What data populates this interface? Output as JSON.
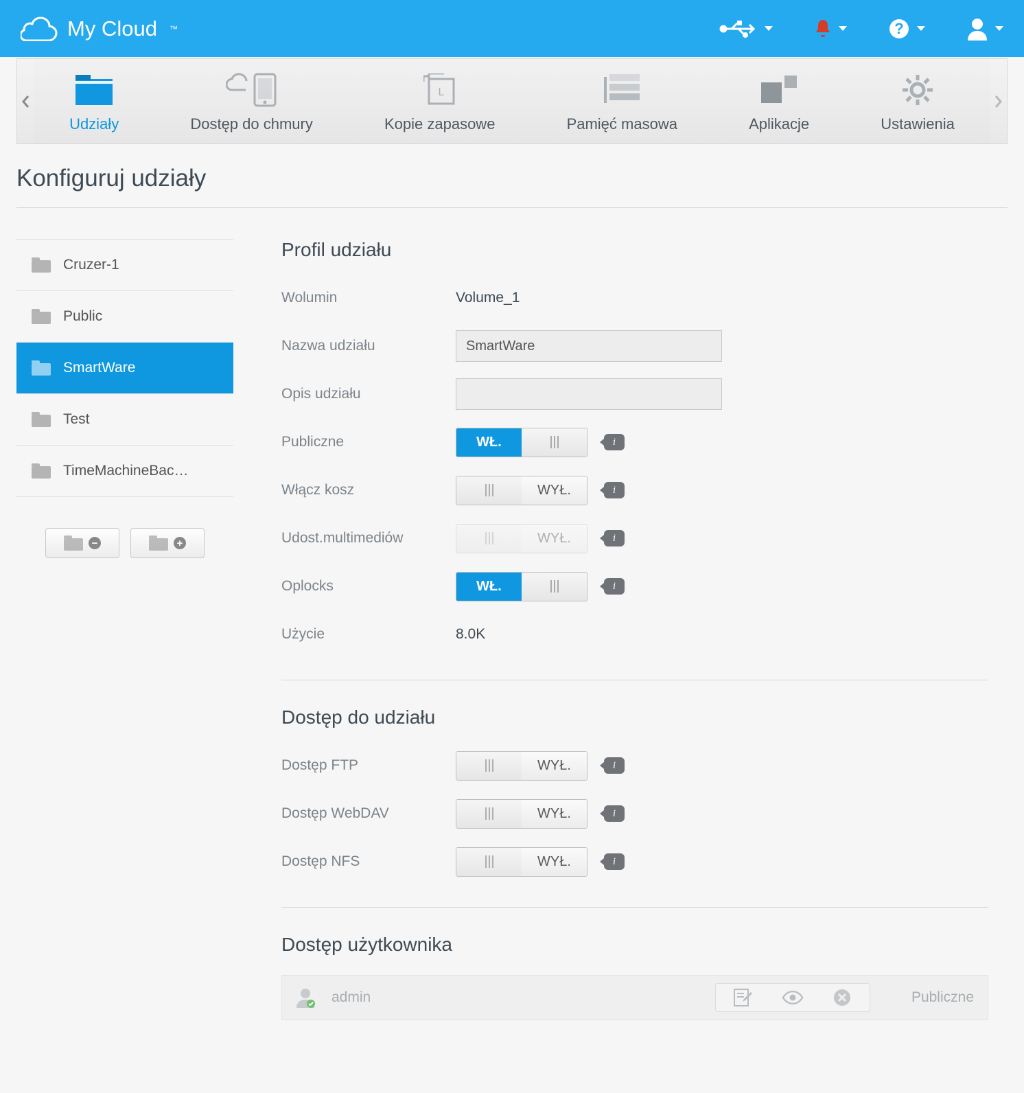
{
  "brand": "My Cloud",
  "nav": [
    {
      "label": "Udziały",
      "active": true
    },
    {
      "label": "Dostęp do chmury"
    },
    {
      "label": "Kopie zapasowe"
    },
    {
      "label": "Pamięć masowa"
    },
    {
      "label": "Aplikacje"
    },
    {
      "label": "Ustawienia"
    }
  ],
  "page_title": "Konfiguruj udziały",
  "shares": [
    {
      "name": "Cruzer-1"
    },
    {
      "name": "Public"
    },
    {
      "name": "SmartWare",
      "selected": true
    },
    {
      "name": "Test"
    },
    {
      "name": "TimeMachineBac…"
    }
  ],
  "toggle_labels": {
    "on": "WŁ.",
    "off": "WYŁ."
  },
  "profile": {
    "title": "Profil udziału",
    "volume_label": "Wolumin",
    "volume_value": "Volume_1",
    "name_label": "Nazwa udziału",
    "name_value": "SmartWare",
    "desc_label": "Opis udziału",
    "desc_value": "",
    "public_label": "Publiczne",
    "public_state": "on",
    "recycle_label": "Włącz kosz",
    "recycle_state": "off",
    "media_label": "Udost.multimediów",
    "media_state": "off",
    "media_disabled": true,
    "oplocks_label": "Oplocks",
    "oplocks_state": "on",
    "usage_label": "Użycie",
    "usage_value": "8.0K"
  },
  "access": {
    "title": "Dostęp do udziału",
    "ftp_label": "Dostęp FTP",
    "ftp_state": "off",
    "webdav_label": "Dostęp WebDAV",
    "webdav_state": "off",
    "nfs_label": "Dostęp NFS",
    "nfs_state": "off"
  },
  "user_access": {
    "title": "Dostęp użytkownika",
    "user": "admin",
    "permission": "Publiczne"
  }
}
